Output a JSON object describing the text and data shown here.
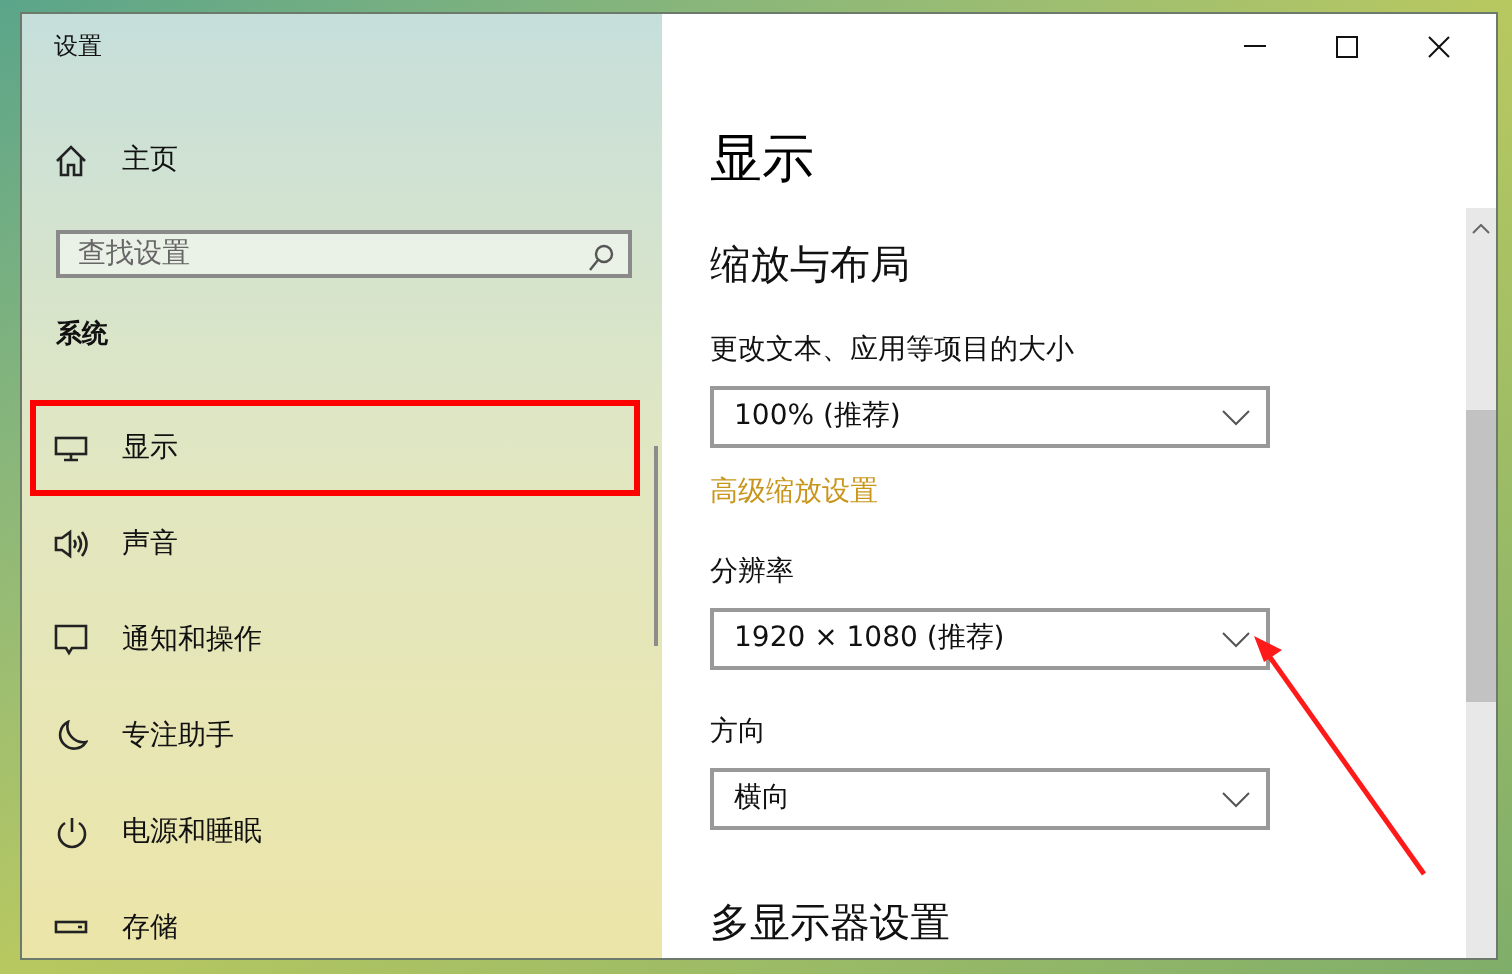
{
  "window": {
    "title": "设置"
  },
  "sidebar": {
    "home": "主页",
    "search": {
      "placeholder": "查找设置"
    },
    "section": "系统",
    "items": [
      {
        "label": "显示",
        "highlighted": true
      },
      {
        "label": "声音",
        "highlighted": false
      },
      {
        "label": "通知和操作",
        "highlighted": false
      },
      {
        "label": "专注助手",
        "highlighted": false
      },
      {
        "label": "电源和睡眠",
        "highlighted": false
      },
      {
        "label": "存储",
        "highlighted": false
      }
    ]
  },
  "content": {
    "title": "显示",
    "heading": "缩放与布局",
    "settings": [
      {
        "kind": "dropdown",
        "label": "更改文本、应用等项目的大小",
        "value": "100% (推荐)",
        "pointed": false
      },
      {
        "kind": "link",
        "label": "高级缩放设置"
      },
      {
        "kind": "dropdown",
        "label": "分辨率",
        "value": "1920 × 1080 (推荐)",
        "pointed": true
      },
      {
        "kind": "dropdown",
        "label": "方向",
        "value": "横向",
        "pointed": false
      }
    ],
    "next_heading": "多显示器设置"
  }
}
